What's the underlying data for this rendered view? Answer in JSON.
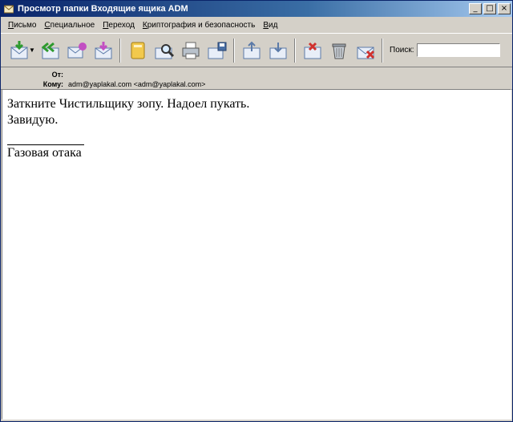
{
  "window": {
    "title": "Просмотр папки Входящие ящика ADM",
    "btn_minimize": "_",
    "btn_maximize": "□",
    "btn_close": "×"
  },
  "menu": [
    {
      "label": "Письмо"
    },
    {
      "label": "Специальное"
    },
    {
      "label": "Переход"
    },
    {
      "label": "Криптография и безопасность"
    },
    {
      "label": "Вид"
    }
  ],
  "toolbar": {
    "icons": [
      "get-mail-icon",
      "reply-all-icon",
      "forward-icon",
      "new-message-icon",
      "address-book-icon",
      "find-icon",
      "print-icon",
      "save-icon",
      "move-icon",
      "copy-icon",
      "delete-icon",
      "trash-icon",
      "spam-icon"
    ],
    "search_label": "Поиск:",
    "search_value": ""
  },
  "headers": {
    "from_label": "От:",
    "from_value": "",
    "to_label": "Кому:",
    "to_value": "adm@yaplakal.com <adm@yaplakal.com>"
  },
  "message": {
    "line1": "Заткните Чистильщику зопу. Надоел пукать.",
    "line2": "Завидую.",
    "signature": "Газовая отака"
  }
}
